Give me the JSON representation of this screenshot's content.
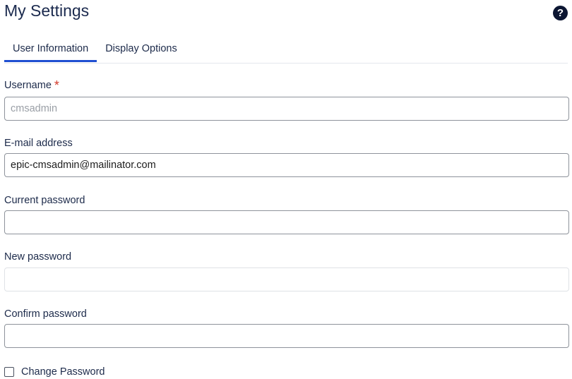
{
  "header": {
    "title": "My Settings",
    "help_icon": "question-circle-icon",
    "help_glyph": "?"
  },
  "tabs": [
    {
      "label": "User Information",
      "active": true
    },
    {
      "label": "Display Options",
      "active": false
    }
  ],
  "form": {
    "username": {
      "label": "Username",
      "required_mark": "*",
      "value": "cmsadmin"
    },
    "email": {
      "label": "E-mail address",
      "value": "epic-cmsadmin@mailinator.com"
    },
    "current_password": {
      "label": "Current password",
      "value": ""
    },
    "new_password": {
      "label": "New password",
      "value": ""
    },
    "confirm_password": {
      "label": "Confirm password",
      "value": ""
    },
    "change_password": {
      "label": "Change Password",
      "checked": false
    }
  },
  "colors": {
    "accent": "#1f4fd1",
    "required": "#d33b2c",
    "text": "#1c2a4a",
    "help_bg": "#0c1632"
  }
}
